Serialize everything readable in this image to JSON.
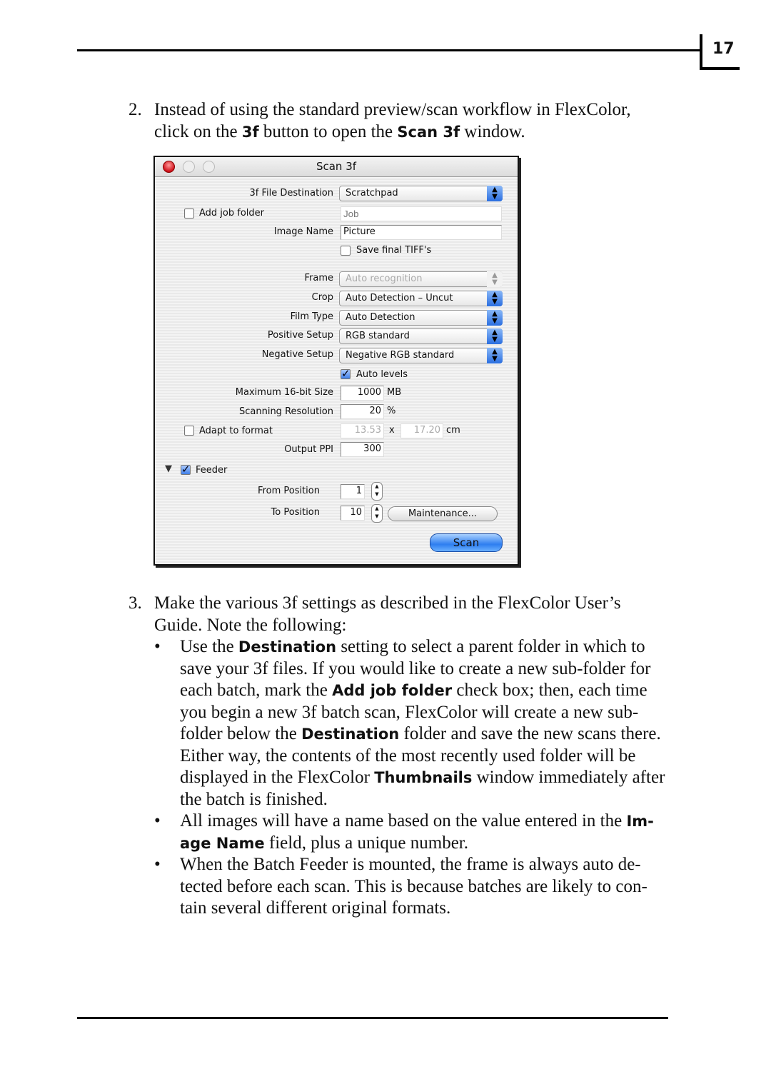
{
  "page_number": "17",
  "step2": {
    "number": "2.",
    "lines": [
      [
        {
          "t": "Instead of using the standard preview/scan workflow in FlexColor,"
        }
      ],
      [
        {
          "t": "click on the "
        },
        {
          "t": "3f",
          "b": true
        },
        {
          "t": " button to open the "
        },
        {
          "t": "Scan 3f",
          "b": true
        },
        {
          "t": " window."
        }
      ]
    ]
  },
  "window": {
    "title": "Scan 3f",
    "dest_label": "3f File Destination",
    "dest_value": "Scratchpad",
    "add_job_label": "Add job folder",
    "job_placeholder": "Job",
    "image_name_label": "Image Name",
    "image_name_value": "Picture",
    "save_tiff_label": "Save final TIFF's",
    "frame_label": "Frame",
    "frame_value": "Auto recognition",
    "crop_label": "Crop",
    "crop_value": "Auto Detection – Uncut",
    "film_label": "Film Type",
    "film_value": "Auto Detection",
    "pos_label": "Positive Setup",
    "pos_value": "RGB standard",
    "neg_label": "Negative Setup",
    "neg_value": "Negative RGB standard",
    "auto_levels_label": "Auto levels",
    "max_label": "Maximum 16-bit Size",
    "max_value": "1000",
    "max_unit": "MB",
    "res_label": "Scanning Resolution",
    "res_value": "20",
    "res_unit": "%",
    "adapt_label": "Adapt to format",
    "width_value": "13.53",
    "times": "x",
    "height_value": "17.20",
    "size_unit": "cm",
    "ppi_label": "Output PPI",
    "ppi_value": "300",
    "feeder_label": "Feeder",
    "from_label": "From Position",
    "from_value": "1",
    "to_label": "To Position",
    "to_value": "10",
    "maintenance": "Maintenance...",
    "scan": "Scan"
  },
  "step3": {
    "number": "3.",
    "lines": [
      [
        {
          "t": "Make the various 3f settings as described in the FlexColor User’s"
        }
      ],
      [
        {
          "t": "Guide. Note the following:"
        }
      ]
    ]
  },
  "bullets": [
    {
      "lines": [
        [
          {
            "t": "Use the "
          },
          {
            "t": "Destination",
            "b": true
          },
          {
            "t": " setting to select a parent folder in which to"
          }
        ],
        [
          {
            "t": "save your 3f files. If you would like to create a new sub-folder for"
          }
        ],
        [
          {
            "t": "each batch, mark the "
          },
          {
            "t": "Add job folder",
            "b": true
          },
          {
            "t": " check box; then, each time"
          }
        ],
        [
          {
            "t": "you begin a new 3f batch scan, FlexColor will create a new sub-"
          }
        ],
        [
          {
            "t": "folder below the "
          },
          {
            "t": "Destination",
            "b": true
          },
          {
            "t": " folder and save the new scans there."
          }
        ],
        [
          {
            "t": "Either way, the contents of the most recently used folder will be"
          }
        ],
        [
          {
            "t": "displayed in the FlexColor "
          },
          {
            "t": "Thumbnails",
            "b": true
          },
          {
            "t": " window immediately after"
          }
        ],
        [
          {
            "t": "the batch is finished."
          }
        ]
      ]
    },
    {
      "lines": [
        [
          {
            "t": "All images will have a name based on the value entered in the "
          },
          {
            "t": "Im-",
            "b": true
          }
        ],
        [
          {
            "t": "age Name",
            "b": true
          },
          {
            "t": " field, plus a unique number."
          }
        ]
      ]
    },
    {
      "lines": [
        [
          {
            "t": "When the Batch Feeder is mounted, the frame is always auto de-"
          }
        ],
        [
          {
            "t": "tected before each scan. This is because batches are likely to con-"
          }
        ],
        [
          {
            "t": "tain several different original formats."
          }
        ]
      ]
    }
  ],
  "bullet_glyph": "•"
}
